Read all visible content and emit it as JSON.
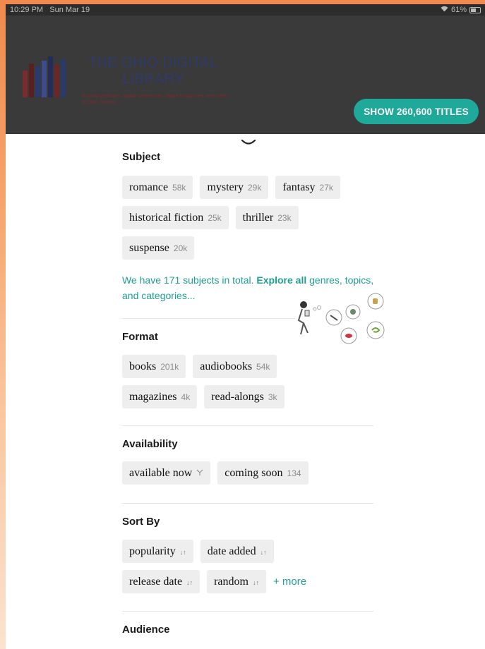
{
  "status_bar": {
    "time": "10:29 PM",
    "date": "Sun Mar 19",
    "battery": "61%"
  },
  "library": {
    "title": "THE OHIO DIGITAL LIBRARY",
    "tagline": "Providing eBooks, digital audiobooks, digital magazines, and video to Ohio citizens."
  },
  "show_button": "SHOW 260,600 TITLES",
  "subject": {
    "title": "Subject",
    "chips": [
      {
        "label": "romance",
        "count": "58k"
      },
      {
        "label": "mystery",
        "count": "29k"
      },
      {
        "label": "fantasy",
        "count": "27k"
      },
      {
        "label": "historical fiction",
        "count": "25k"
      },
      {
        "label": "thriller",
        "count": "23k"
      },
      {
        "label": "suspense",
        "count": "20k"
      }
    ],
    "explore_pre": "We have 171 subjects in total. ",
    "explore_link": "Explore all",
    "explore_post": " genres, topics, and categories..."
  },
  "format": {
    "title": "Format",
    "chips": [
      {
        "label": "books",
        "count": "201k"
      },
      {
        "label": "audiobooks",
        "count": "54k"
      },
      {
        "label": "magazines",
        "count": "4k"
      },
      {
        "label": "read-alongs",
        "count": "3k"
      }
    ]
  },
  "availability": {
    "title": "Availability",
    "chips": [
      {
        "label": "available now",
        "icon": "filter-icon"
      },
      {
        "label": "coming soon",
        "count": "134"
      }
    ]
  },
  "sort_by": {
    "title": "Sort By",
    "chips": [
      {
        "label": "popularity",
        "icon": "sort-arrows-icon"
      },
      {
        "label": "date added",
        "icon": "sort-arrows-icon"
      },
      {
        "label": "release date",
        "icon": "sort-arrows-icon"
      },
      {
        "label": "random",
        "icon": "sort-arrows-icon"
      }
    ],
    "more": "+ more"
  },
  "audience": {
    "title": "Audience"
  },
  "colors": {
    "accent": "#1ea99a",
    "chip_bg": "#eeeeee",
    "header_bg": "#3a3a3a"
  }
}
